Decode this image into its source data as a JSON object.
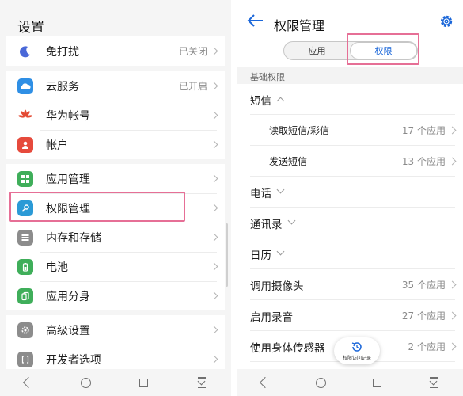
{
  "left_screen": {
    "title": "设置",
    "groups": [
      {
        "items": [
          {
            "label": "免打扰",
            "status": "已关闭",
            "icon": "moon-icon",
            "color": "#4a68d8"
          }
        ]
      },
      {
        "items": [
          {
            "label": "云服务",
            "status": "已开启",
            "icon": "cloud-icon",
            "color": "#2f8fe5"
          },
          {
            "label": "华为帐号",
            "status": "",
            "icon": "huawei-logo-icon",
            "color": "#e34a33"
          },
          {
            "label": "帐户",
            "status": "",
            "icon": "account-icon",
            "color": "#e64a3c"
          }
        ]
      },
      {
        "items": [
          {
            "label": "应用管理",
            "status": "",
            "icon": "apps-grid-icon",
            "color": "#3fae5a"
          },
          {
            "label": "权限管理",
            "status": "",
            "icon": "key-icon",
            "color": "#2b9ad6"
          },
          {
            "label": "内存和存储",
            "status": "",
            "icon": "storage-icon",
            "color": "#8c8c8c"
          },
          {
            "label": "电池",
            "status": "",
            "icon": "battery-icon",
            "color": "#3fae5a"
          },
          {
            "label": "应用分身",
            "status": "",
            "icon": "app-twin-icon",
            "color": "#3fae5a"
          }
        ]
      },
      {
        "items": [
          {
            "label": "高级设置",
            "status": "",
            "icon": "gear-icon",
            "color": "#8c8c8c"
          },
          {
            "label": "开发者选项",
            "status": "",
            "icon": "developer-brackets-icon",
            "color": "#8c8c8c"
          }
        ]
      }
    ]
  },
  "right_screen": {
    "title": "权限管理",
    "tabs": [
      {
        "label": "应用",
        "active": false
      },
      {
        "label": "权限",
        "active": true
      }
    ],
    "section_header": "基础权限",
    "rows": [
      {
        "label": "短信",
        "count": "",
        "expand": "up",
        "sub": false
      },
      {
        "label": "读取短信/彩信",
        "count": "17 个应用",
        "expand": "",
        "sub": true
      },
      {
        "label": "发送短信",
        "count": "13 个应用",
        "expand": "",
        "sub": true
      },
      {
        "label": "电话",
        "count": "",
        "expand": "down",
        "sub": false
      },
      {
        "label": "通讯录",
        "count": "",
        "expand": "down",
        "sub": false
      },
      {
        "label": "日历",
        "count": "",
        "expand": "down",
        "sub": false
      },
      {
        "label": "调用摄像头",
        "count": "35 个应用",
        "expand": "",
        "sub": false
      },
      {
        "label": "启用录音",
        "count": "27 个应用",
        "expand": "",
        "sub": false
      },
      {
        "label": "使用身体传感器",
        "count": "2 个应用",
        "expand": "",
        "sub": false
      }
    ],
    "fab_label": "权限访问记录"
  },
  "colors": {
    "highlight": "#e66f96",
    "accent": "#1a66d9"
  }
}
